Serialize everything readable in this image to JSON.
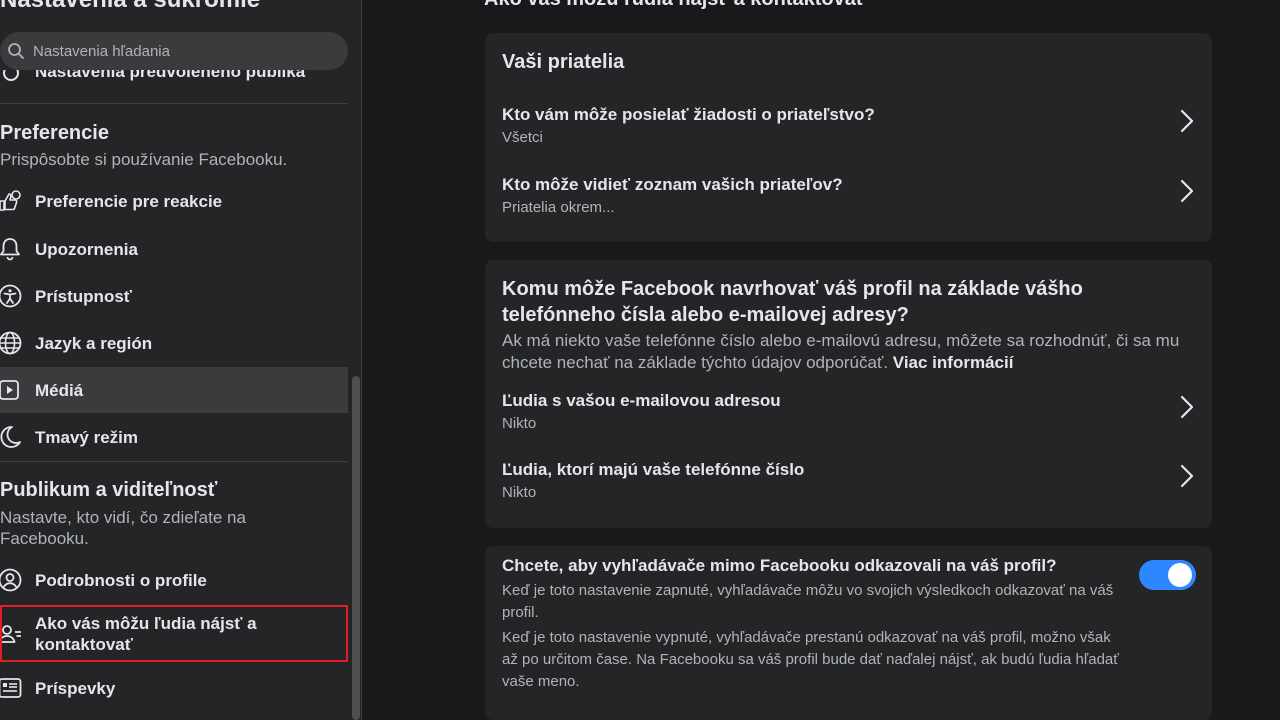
{
  "sidebar": {
    "title": "Nastavenia a súkromie",
    "search_placeholder": "Nastavenia hľadania",
    "clipped_item": "Nastavenia predvoleného publika",
    "preferences": {
      "title": "Preferencie",
      "desc": "Prispôsobte si používanie Facebooku.",
      "items": [
        {
          "label": "Preferencie pre reakcie",
          "icon": "reactions-icon"
        },
        {
          "label": "Upozornenia",
          "icon": "bell-icon"
        },
        {
          "label": "Prístupnosť",
          "icon": "accessibility-icon"
        },
        {
          "label": "Jazyk a región",
          "icon": "globe-icon"
        },
        {
          "label": "Médiá",
          "icon": "media-icon"
        },
        {
          "label": "Tmavý režim",
          "icon": "moon-icon"
        }
      ]
    },
    "audience": {
      "title": "Publikum a viditeľnosť",
      "desc": "Nastavte, kto vidí, čo zdieľate na Facebooku.",
      "items": [
        {
          "label": "Podrobnosti o profile",
          "icon": "user-circle-icon"
        },
        {
          "label": "Ako vás môžu ľudia nájsť a kontaktovať",
          "icon": "find-people-icon"
        },
        {
          "label": "Príspevky",
          "icon": "posts-icon"
        }
      ]
    }
  },
  "main": {
    "title": "Ako vás môžu ľudia nájsť a kontaktovať",
    "friends_card": {
      "title": "Vaši priatelia",
      "rows": [
        {
          "question": "Kto vám môže posielať žiadosti o priateľstvo?",
          "value": "Všetci"
        },
        {
          "question": "Kto môže vidieť zoznam vašich priateľov?",
          "value": "Priatelia okrem..."
        }
      ]
    },
    "suggest_card": {
      "title": "Komu môže Facebook navrhovať váš profil na základe vášho telefónneho čísla alebo e-mailovej adresy?",
      "desc": "Ak má niekto vaše telefónne číslo alebo e-mailovú adresu, môžete sa rozhodnúť, či sa mu chcete nechať na základe týchto údajov odporúčať.",
      "more_link": "Viac informácií",
      "rows": [
        {
          "question": "Ľudia s vašou e-mailovou adresou",
          "value": "Nikto"
        },
        {
          "question": "Ľudia, ktorí majú vaše telefónne číslo",
          "value": "Nikto"
        }
      ]
    },
    "search_card": {
      "title": "Chcete, aby vyhľadávače mimo Facebooku odkazovali na váš profil?",
      "text_on": "Keď je toto nastavenie zapnuté, vyhľadávače môžu vo svojich výsledkoch odkazovať na váš profil.",
      "text_off": "Keď je toto nastavenie vypnuté, vyhľadávače prestanú odkazovať na váš profil, možno však až po určitom čase. Na Facebooku sa váš profil bude dať naďalej nájsť, ak budú ľudia hľadať vaše meno.",
      "toggle_on": true
    }
  },
  "colors": {
    "background": "#18191a",
    "card": "#242526",
    "accent": "#2d88ff",
    "selection_outline": "#e41e26"
  }
}
